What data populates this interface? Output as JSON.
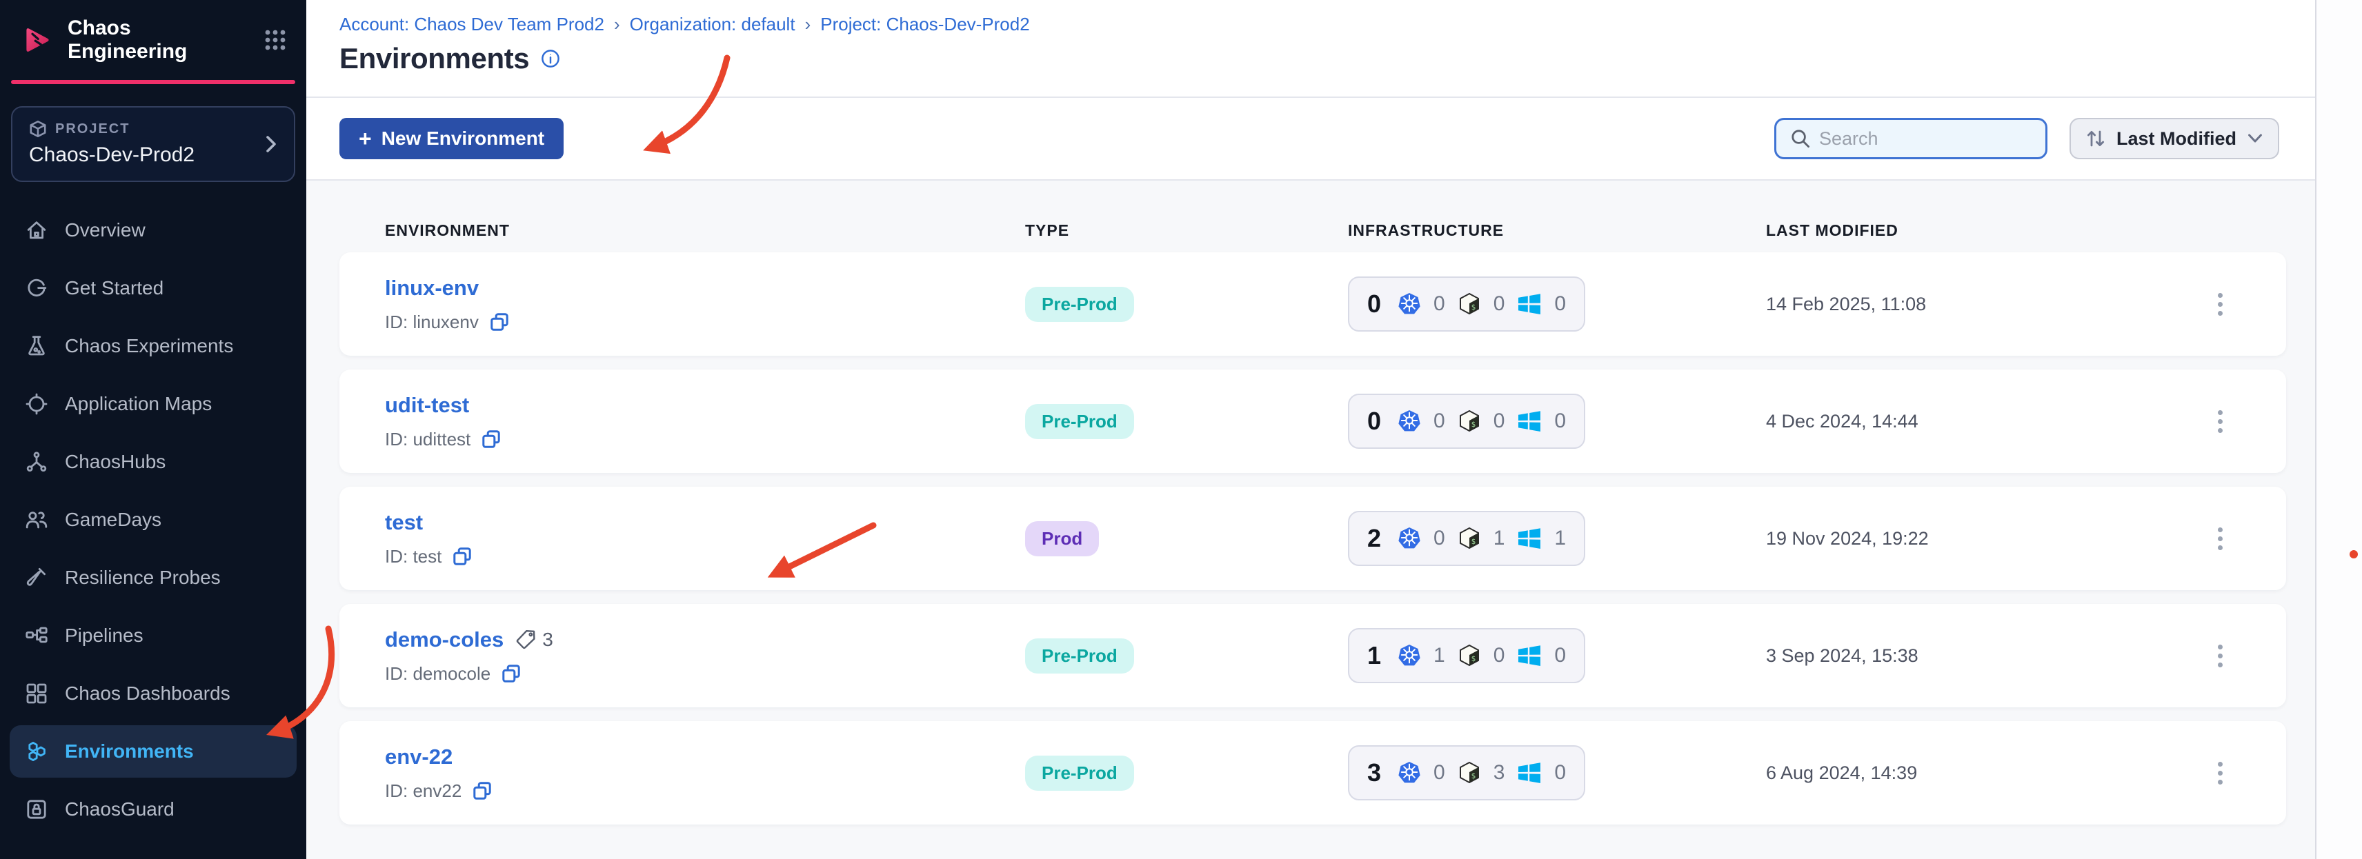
{
  "brand": {
    "app_title": "Chaos Engineering"
  },
  "project_selector": {
    "label": "PROJECT",
    "name": "Chaos-Dev-Prod2"
  },
  "sidebar": {
    "items": [
      {
        "label": "Overview",
        "icon": "home-icon",
        "active": false
      },
      {
        "label": "Get Started",
        "icon": "get-started-icon",
        "active": false
      },
      {
        "label": "Chaos Experiments",
        "icon": "flask-icon",
        "active": false
      },
      {
        "label": "Application Maps",
        "icon": "target-icon",
        "active": false
      },
      {
        "label": "ChaosHubs",
        "icon": "network-icon",
        "active": false
      },
      {
        "label": "GameDays",
        "icon": "people-icon",
        "active": false
      },
      {
        "label": "Resilience Probes",
        "icon": "test-tube-icon",
        "active": false
      },
      {
        "label": "Pipelines",
        "icon": "pipeline-icon",
        "active": false
      },
      {
        "label": "Chaos Dashboards",
        "icon": "dashboard-icon",
        "active": false
      },
      {
        "label": "Environments",
        "icon": "hexagons-icon",
        "active": true
      },
      {
        "label": "ChaosGuard",
        "icon": "lock-icon",
        "active": false
      }
    ]
  },
  "breadcrumb": {
    "separator": "›",
    "items": [
      "Account: Chaos Dev Team Prod2",
      "Organization: default",
      "Project: Chaos-Dev-Prod2"
    ]
  },
  "page": {
    "title": "Environments"
  },
  "toolbar": {
    "plus": "+",
    "new_environment_label": "New Environment",
    "search_placeholder": "Search",
    "sort_label": "Last Modified"
  },
  "table": {
    "headers": {
      "environment": "ENVIRONMENT",
      "type": "TYPE",
      "infrastructure": "INFRASTRUCTURE",
      "last_modified": "LAST MODIFIED"
    },
    "rows": [
      {
        "name": "linux-env",
        "id_label": "ID: linuxenv",
        "tags": null,
        "type": "Pre-Prod",
        "type_variant": "preprod",
        "total": "0",
        "k8s": "0",
        "linux": "0",
        "windows": "0",
        "last_modified": "14 Feb 2025, 11:08"
      },
      {
        "name": "udit-test",
        "id_label": "ID: udittest",
        "tags": null,
        "type": "Pre-Prod",
        "type_variant": "preprod",
        "total": "0",
        "k8s": "0",
        "linux": "0",
        "windows": "0",
        "last_modified": "4 Dec 2024, 14:44"
      },
      {
        "name": "test",
        "id_label": "ID: test",
        "tags": null,
        "type": "Prod",
        "type_variant": "prod",
        "total": "2",
        "k8s": "0",
        "linux": "1",
        "windows": "1",
        "last_modified": "19 Nov 2024, 19:22"
      },
      {
        "name": "demo-coles",
        "id_label": "ID: democole",
        "tags": "3",
        "type": "Pre-Prod",
        "type_variant": "preprod",
        "total": "1",
        "k8s": "1",
        "linux": "0",
        "windows": "0",
        "last_modified": "3 Sep 2024, 15:38"
      },
      {
        "name": "env-22",
        "id_label": "ID: env22",
        "tags": null,
        "type": "Pre-Prod",
        "type_variant": "preprod",
        "total": "3",
        "k8s": "0",
        "linux": "3",
        "windows": "0",
        "last_modified": "6 Aug 2024, 14:39"
      }
    ]
  },
  "colors": {
    "accent_pink": "#f0306a",
    "link_blue": "#2e6bd4",
    "button_blue": "#2a4fa8",
    "active_nav_blue": "#41b5f6",
    "preprod_bg": "#d3f6f3",
    "preprod_text": "#0ba7a0",
    "prod_bg": "#e4d7f9",
    "prod_text": "#5d2db5",
    "annotation_arrow_red": "#e8452c",
    "kubernetes_blue": "#326ce5",
    "windows_blue": "#00adef",
    "sidebar_bg": "#0b1322"
  }
}
